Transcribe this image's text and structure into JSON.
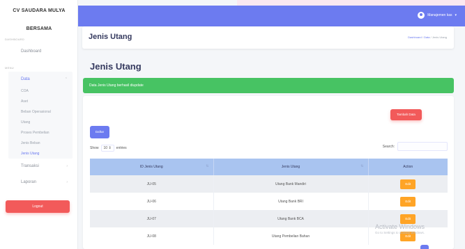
{
  "brand": {
    "line1": "CV SAUDARA MULYA",
    "line2": "BERSAMA"
  },
  "sidebar": {
    "section_dashboard": "DASHBOARD",
    "dashboard": "Dashboard",
    "section_menu": "MENU",
    "data": "Data",
    "sub_items": [
      "COA",
      "Aset",
      "Beban Operasional",
      "Utang",
      "Proses Pembelian",
      "Jenis Beban",
      "Jenis Utang"
    ],
    "transaksi": "Transaksi",
    "laporan": "Laporan",
    "logout": "Logout"
  },
  "navbar": {
    "user": "Manajemen kas"
  },
  "header": {
    "title": "Jenis Utang",
    "breadcrumb": [
      "Dashboard",
      "Data",
      "Jenis Utang"
    ]
  },
  "page": {
    "title": "Jenis Utang",
    "alert": "Data Jenis Utang berhasil diupdate"
  },
  "card": {
    "add_button": "Tambah Data",
    "list_button": "Daftar",
    "show_label": "Show",
    "entries_value": "10",
    "entries_label": "entries",
    "search_label": "Search:"
  },
  "table": {
    "headers": [
      "ID Jenis Utang",
      "Jenis Utang",
      "Action"
    ],
    "rows": [
      {
        "id": "JU-05",
        "name": "Utang Bank Mandiri",
        "action": "Edit"
      },
      {
        "id": "JU-06",
        "name": "Utang Bank BRI",
        "action": "Edit"
      },
      {
        "id": "JU-07",
        "name": "Utang Bank BCA",
        "action": "Edit"
      },
      {
        "id": "JU-08",
        "name": "Utang Pembelian Bahan",
        "action": "Edit"
      }
    ]
  },
  "watermark": {
    "title": "Activate Windows",
    "subtitle": "Go to Settings to activate Windows."
  },
  "colors": {
    "primary": "#6c7bf0",
    "success": "#47c363",
    "danger": "#f25a5a",
    "warning": "#ffa426"
  }
}
